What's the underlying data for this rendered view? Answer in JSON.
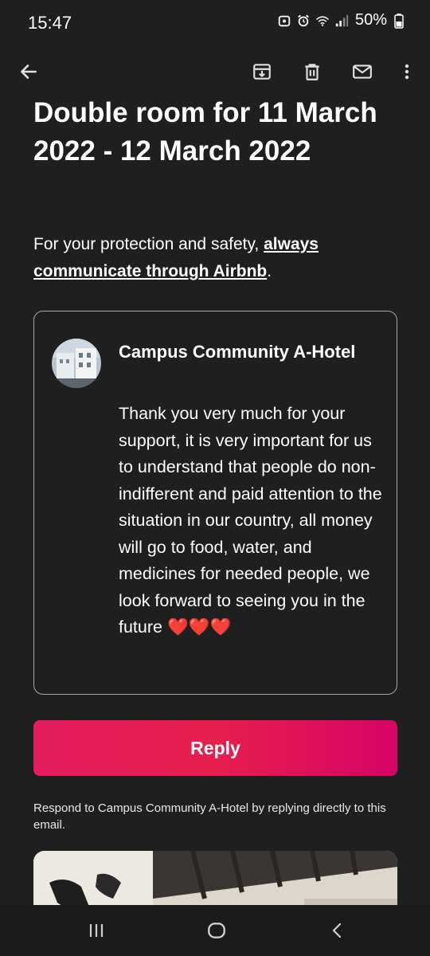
{
  "status_bar": {
    "time": "15:47",
    "battery": "50%",
    "icons": [
      "data-saver-icon",
      "alarm-icon",
      "wifi-icon",
      "signal-icon",
      "battery-icon"
    ]
  },
  "app_bar": {
    "actions": [
      "back-arrow-icon",
      "archive-icon",
      "delete-icon",
      "mark-unread-icon",
      "more-vert-icon"
    ]
  },
  "email": {
    "heading": "Double room for 11 March 2022 - 12 March 2022",
    "safety_prefix": "For your protection and safety, ",
    "safety_link": "always communicate through Airbnb",
    "safety_suffix": "."
  },
  "message": {
    "sender": "Campus Community A-Hotel",
    "body": "Thank you very much for your support, it is very important for us to understand that people do non- indifferent and paid attention to the situation in our country, all money will go to food, water, and medicines for needed people, we look forward to seeing you in the future ❤️❤️❤️"
  },
  "reply_button": {
    "label": "Reply"
  },
  "respond_note": "Respond to Campus Community A-Hotel by replying directly to this email.",
  "nav_bar": {
    "buttons": [
      "recent-apps-icon",
      "home-icon",
      "back-icon"
    ]
  },
  "colors": {
    "background": "#1f1f1f",
    "accent": "#e61e4d",
    "card_border": "#a8a8a8"
  }
}
